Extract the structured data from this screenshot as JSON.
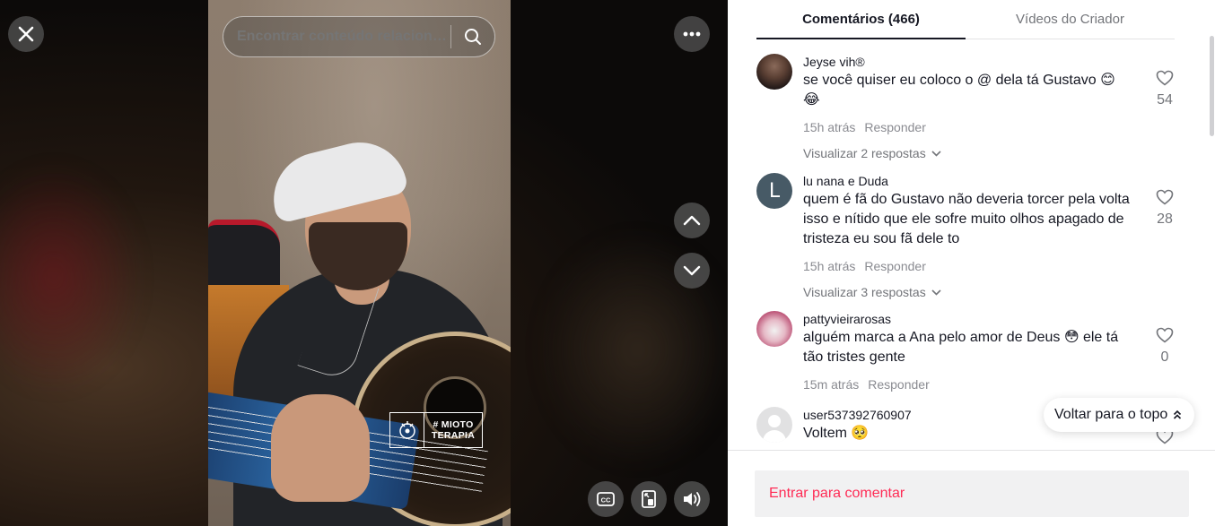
{
  "video": {
    "search_placeholder": "Encontrar conteúdo relacionado",
    "watermark_line1": "# MIOTO",
    "watermark_line2": "TERAPIA"
  },
  "tabs": [
    {
      "label": "Comentários (466)",
      "active": true
    },
    {
      "label": "Vídeos do Criador",
      "active": false
    }
  ],
  "comments": [
    {
      "user": "Jeyse vih®",
      "text": "se você quiser eu coloco o @ dela tá Gustavo 😊 😂",
      "time": "15h atrás",
      "reply_label": "Responder",
      "replies": "Visualizar 2 respostas",
      "likes": "54"
    },
    {
      "user": "lu nana e Duda",
      "avatar_letter": "L",
      "text": "quem é fã do Gustavo não deveria torcer pela volta isso e nítido que ele sofre muito olhos apagado de tristeza eu sou fã dele to",
      "time": "15h atrás",
      "reply_label": "Responder",
      "replies": "Visualizar 3 respostas",
      "likes": "28"
    },
    {
      "user": "pattyvieirarosas",
      "text": "alguém marca a Ana pelo amor de Deus 😳 ele tá tão tristes gente",
      "time": "15m atrás",
      "reply_label": "Responder",
      "likes": "0"
    },
    {
      "user": "user537392760907",
      "text": "Voltem 🥺"
    }
  ],
  "back_to_top": "Voltar para o topo",
  "login_prompt": "Entrar para comentar",
  "colors": {
    "accent": "#fe2c55",
    "text_primary": "#161823",
    "text_secondary": "#8a8b91"
  }
}
